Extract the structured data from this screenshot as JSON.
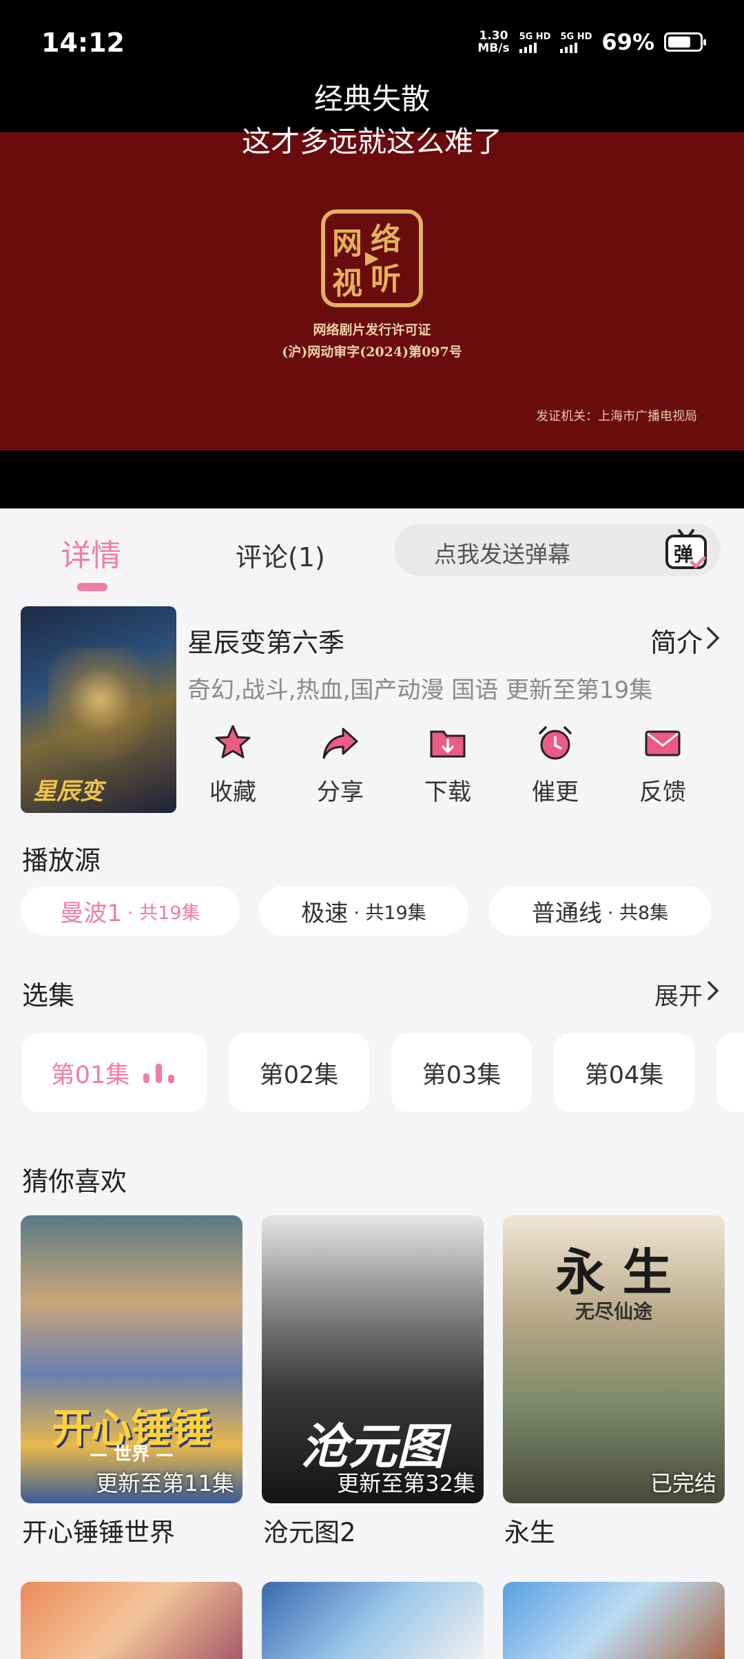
{
  "status_bar": {
    "time": "14:12",
    "net_speed_value": "1.30",
    "net_speed_unit": "MB/s",
    "sim1": "5G HD",
    "sim2": "5G HD",
    "battery_pct": "69%",
    "battery_level": 0.69
  },
  "player": {
    "subtitle_line1": "经典失散",
    "subtitle_line2": "这才多远就这么难了",
    "seal_text": "网络视听",
    "license_title": "网络剧片发行许可证",
    "license_no": "(沪)网动审字(2024)第097号",
    "issuer": "发证机关：上海市广播电视局",
    "bg_color": "#6a0b0e"
  },
  "tabs": {
    "detail": "详情",
    "comment": "评论(1)",
    "danmaku_placeholder": "点我发送弹幕",
    "danmaku_icon_char": "弹"
  },
  "show": {
    "poster_text": "星辰变",
    "title": "星辰变第六季",
    "intro_label": "简介",
    "tags": "奇幻,战斗,热血,国产动漫 国语 更新至第19集"
  },
  "actions": [
    {
      "label": "收藏",
      "icon": "star-icon"
    },
    {
      "label": "分享",
      "icon": "share-icon"
    },
    {
      "label": "下载",
      "icon": "download-folder-icon"
    },
    {
      "label": "催更",
      "icon": "alarm-clock-icon"
    },
    {
      "label": "反馈",
      "icon": "mail-icon"
    }
  ],
  "sources": {
    "heading": "播放源",
    "items": [
      {
        "name": "曼波1",
        "count": "· 共19集",
        "active": true
      },
      {
        "name": "极速",
        "count": "· 共19集",
        "active": false
      },
      {
        "name": "普通线",
        "count": "· 共8集",
        "active": false
      }
    ]
  },
  "episodes": {
    "heading": "选集",
    "expand_label": "展开",
    "items": [
      "第01集",
      "第02集",
      "第03集",
      "第04集"
    ],
    "playing": "第01集"
  },
  "recommend": {
    "heading": "猜你喜欢",
    "items": [
      {
        "name": "开心锤锤世界",
        "badge": "更新至第11集",
        "poster_text": "开心锤锤",
        "poster_sub": "— 世界 —"
      },
      {
        "name": "沧元图2",
        "badge": "更新至第32集",
        "poster_text": "沧元图"
      },
      {
        "name": "永生",
        "badge": "已完结",
        "poster_text": "永 生",
        "poster_sub": "无尽仙途"
      }
    ]
  },
  "colors": {
    "accent": "#f07ea0",
    "background": "#f5f5f7"
  }
}
